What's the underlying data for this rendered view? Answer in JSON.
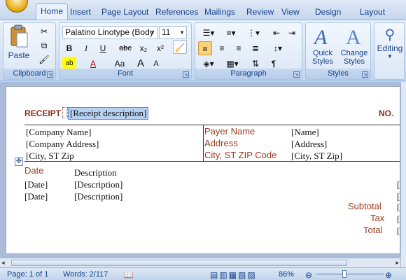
{
  "tabs": [
    "Home",
    "Insert",
    "Page Layout",
    "References",
    "Mailings",
    "Review",
    "View",
    "Design",
    "Layout"
  ],
  "ribbon": {
    "clipboard": {
      "paste": "Paste",
      "label": "Clipboard"
    },
    "font": {
      "name": "Palatino Linotype (Body",
      "size": "11",
      "label": "Font",
      "bold": "B",
      "italic": "I",
      "underline": "U",
      "strike": "abc",
      "subscript": "x₂",
      "superscript": "x²",
      "grow": "A",
      "shrink": "A",
      "case": "Aa"
    },
    "paragraph": {
      "label": "Paragraph"
    },
    "styles": {
      "quick": "Quick Styles",
      "change": "Change Styles",
      "label": "Styles"
    },
    "editing": {
      "label": "Editing"
    }
  },
  "document": {
    "receipt_label": "RECEIPT",
    "receipt_desc": "[Receipt description]",
    "no_label": "NO.",
    "company": [
      "[Company Name]",
      "[Company Address]",
      "[City, ST  Zip"
    ],
    "payer_labels": [
      "Payer Name",
      "Address",
      "City, ST ZIP Code"
    ],
    "payer_values": [
      "[Name]",
      "[Address]",
      "[City, ST  Zip]"
    ],
    "col_date": "Date",
    "col_desc": "Description",
    "rows": [
      {
        "date": "[Date]",
        "desc": "[Description]"
      },
      {
        "date": "[Date]",
        "desc": "[Description]"
      }
    ],
    "totals": [
      "Subtotal",
      "Tax",
      "Total"
    ],
    "amount_stub": "[A"
  },
  "status": {
    "page": "Page: 1 of 1",
    "words": "Words: 2/117",
    "zoom": "86%"
  },
  "colors": {
    "accent": "#15428b",
    "doc_label": "#8a2e16"
  }
}
